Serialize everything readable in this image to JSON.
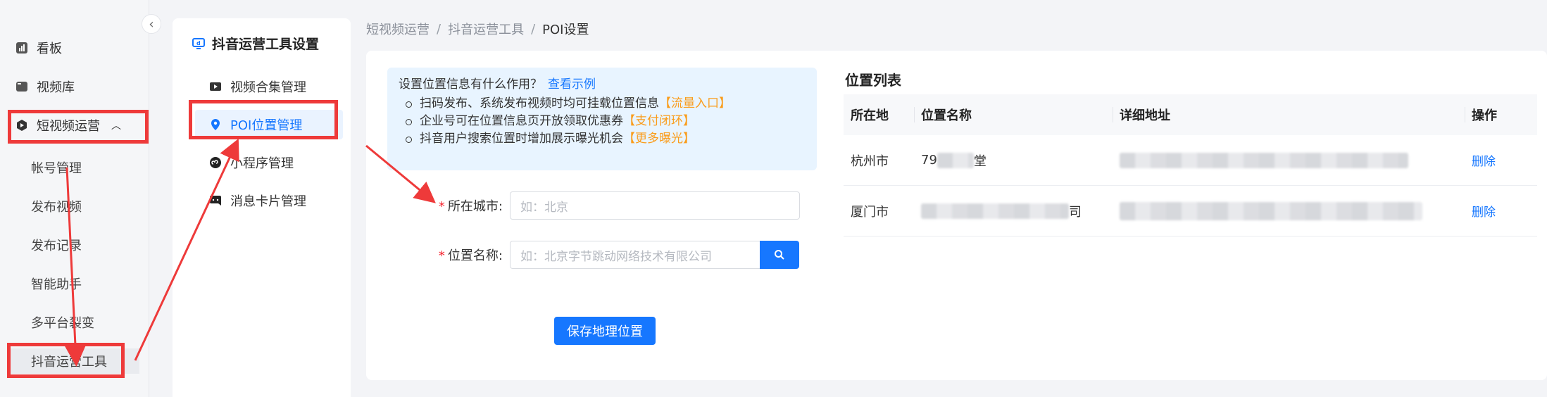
{
  "sidebar": {
    "items": [
      {
        "label": "看板",
        "icon": "chart-icon"
      },
      {
        "label": "视频库",
        "icon": "video-library-icon"
      },
      {
        "label": "短视频运营",
        "icon": "hexagon-play-icon"
      }
    ],
    "sub_items": [
      "帐号管理",
      "发布视频",
      "发布记录",
      "智能助手",
      "多平台裂变",
      "抖音运营工具"
    ]
  },
  "subpanel": {
    "title": "抖音运营工具设置",
    "items": [
      {
        "label": "视频合集管理",
        "icon": "collection-icon"
      },
      {
        "label": "POI位置管理",
        "icon": "location-pin-icon"
      },
      {
        "label": "小程序管理",
        "icon": "mini-program-icon"
      },
      {
        "label": "消息卡片管理",
        "icon": "message-card-icon"
      }
    ]
  },
  "breadcrumb": [
    "短视频运营",
    "抖音运营工具",
    "POI设置"
  ],
  "info": {
    "question": "设置位置信息有什么作用？",
    "link": "查看示例",
    "bullets": [
      {
        "text": "扫码发布、系统发布视频时均可挂载位置信息",
        "tag": "【流量入口】"
      },
      {
        "text": "企业号可在位置信息页开放领取优惠券",
        "tag": "【支付闭环】"
      },
      {
        "text": "抖音用户搜索位置时增加展示曝光机会",
        "tag": "【更多曝光】"
      }
    ]
  },
  "form": {
    "city_label": "所在城市:",
    "city_placeholder": "如：北京",
    "name_label": "位置名称:",
    "name_placeholder": "如：北京字节跳动网络技术有限公司",
    "required_mark": "*",
    "save_label": "保存地理位置"
  },
  "table": {
    "title": "位置列表",
    "headers": [
      "所在地",
      "位置名称",
      "详细地址",
      "操作"
    ],
    "rows": [
      {
        "city": "杭州市",
        "name_prefix": "79",
        "name_suffix": "堂",
        "action": "删除"
      },
      {
        "city": "厦门市",
        "name_prefix": "",
        "name_suffix": "司",
        "action": "删除"
      }
    ]
  },
  "colors": {
    "accent": "#1677ff",
    "highlight": "#ee3a3a",
    "tag_orange": "#fa9c1b",
    "info_bg": "#e8f4ff"
  }
}
